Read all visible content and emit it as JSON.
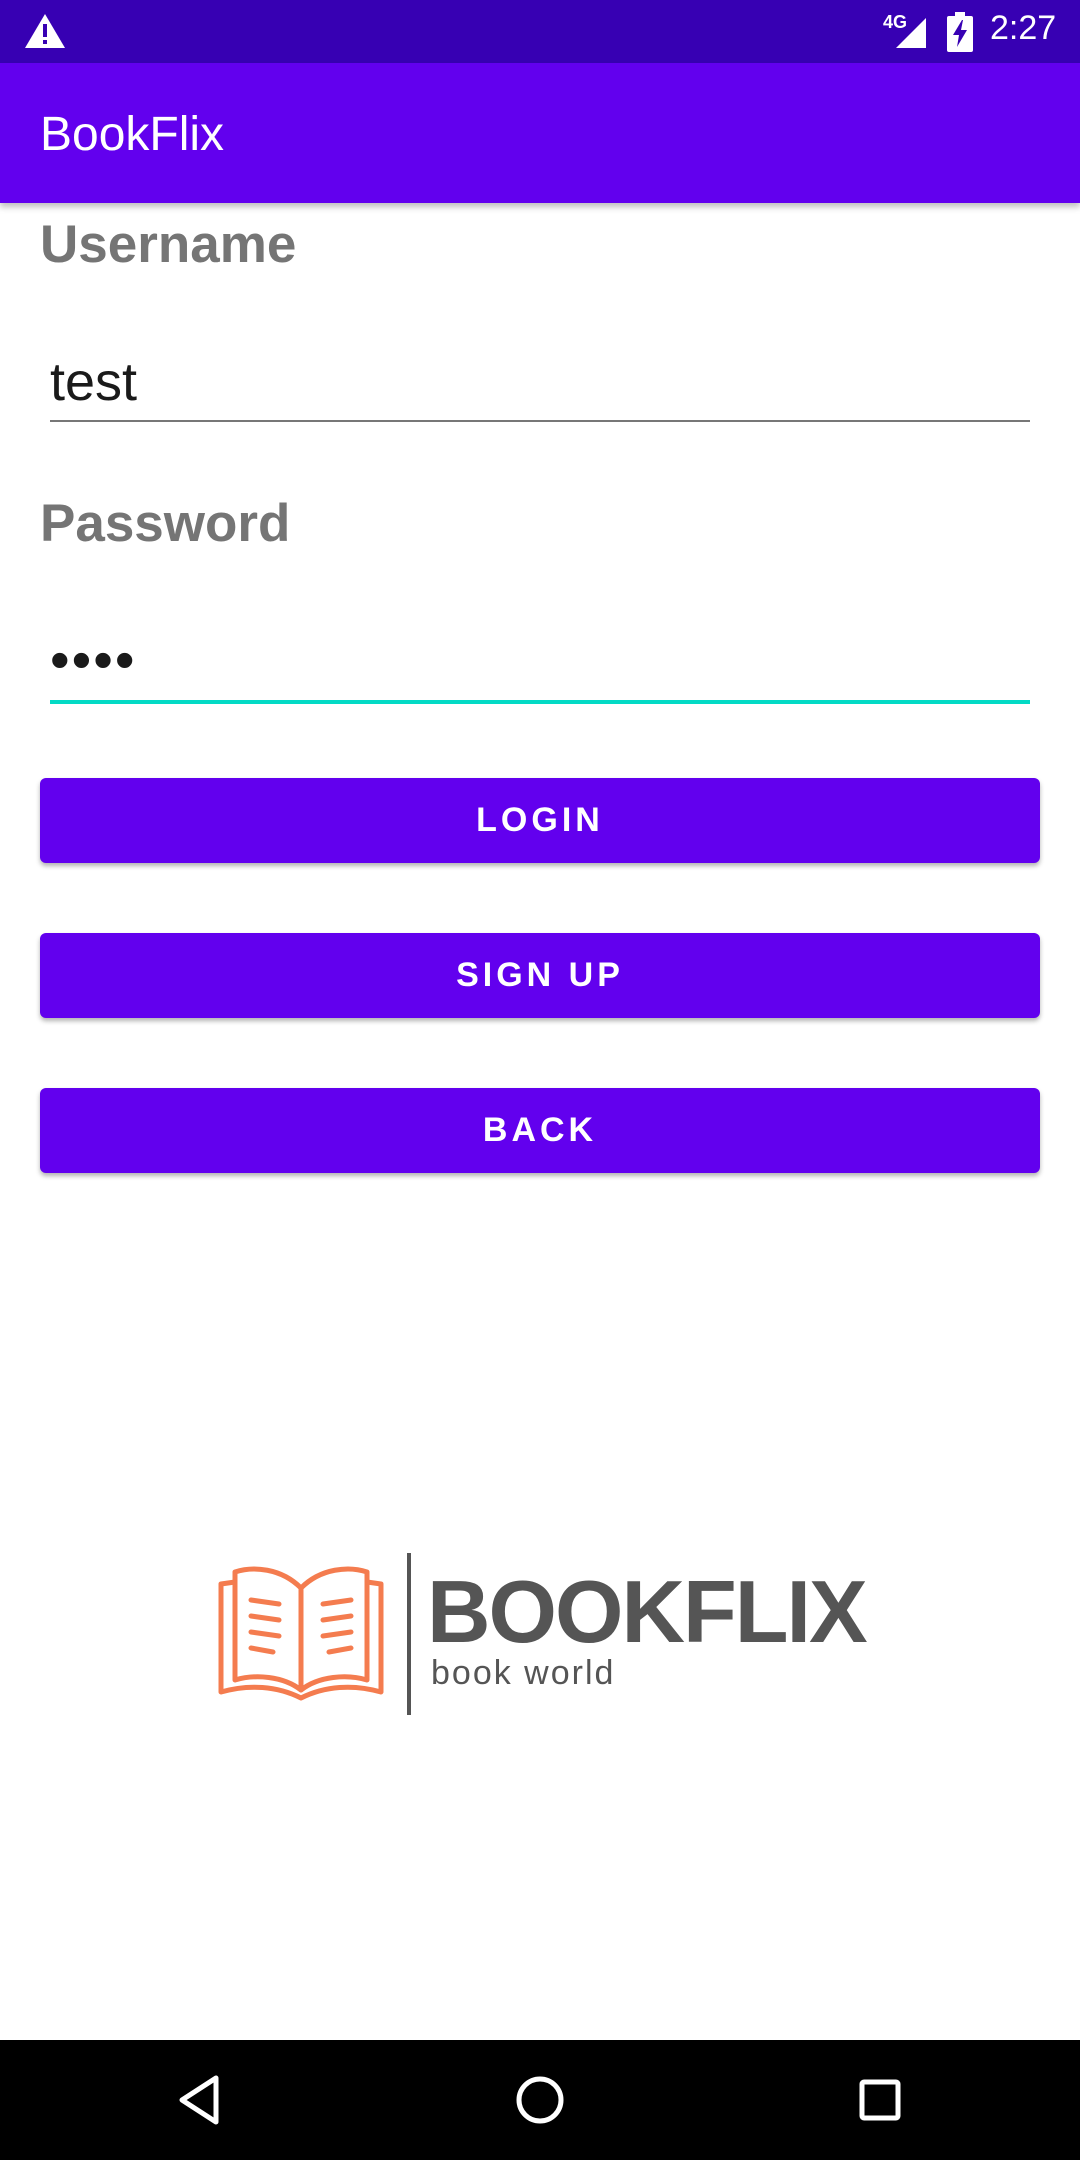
{
  "status_bar": {
    "network": "4G",
    "time": "2:27",
    "icons": [
      "warning-icon",
      "signal-icon",
      "battery-charging-icon"
    ]
  },
  "app_bar": {
    "title": "BookFlix"
  },
  "form": {
    "username_label": "Username",
    "username_value": "test",
    "password_label": "Password",
    "password_value": "••••"
  },
  "buttons": {
    "login": "LOGIN",
    "signup": "SIGN UP",
    "back": "BACK"
  },
  "logo": {
    "brand": "BOOKFLIX",
    "tagline": "book world"
  },
  "nav_bar": {
    "icons": [
      "back-icon",
      "home-icon",
      "recents-icon"
    ]
  },
  "colors": {
    "primary": "#6200EE",
    "primary_dark": "#3700B3",
    "accent": "#03DAC5",
    "label": "#757575",
    "logo_orange": "#F47C4F"
  }
}
